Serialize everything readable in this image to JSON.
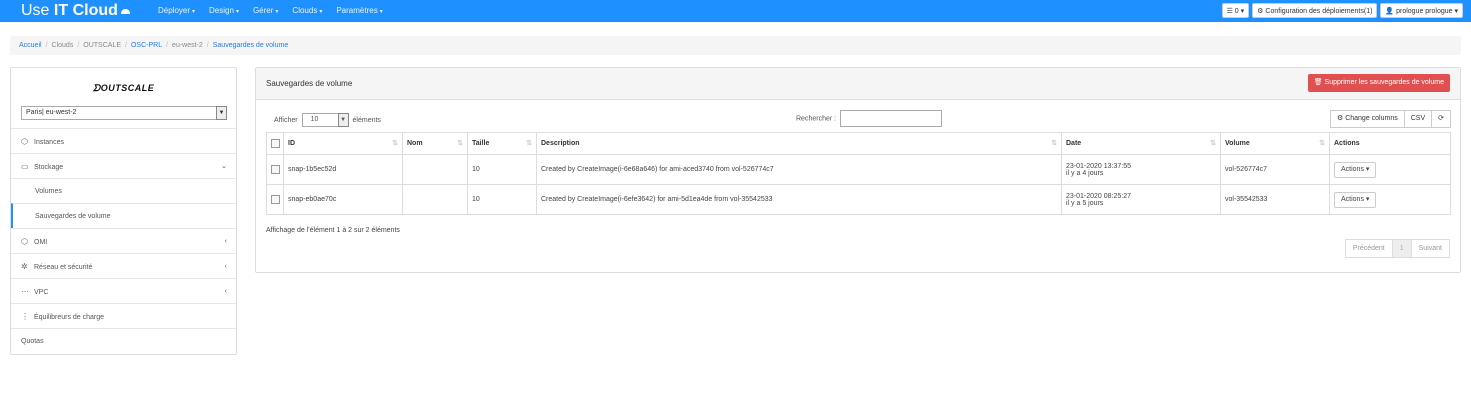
{
  "brand": {
    "light": "Use ",
    "bold": "IT Cloud"
  },
  "nav": [
    {
      "label": "Déployer"
    },
    {
      "label": "Design"
    },
    {
      "label": "Gérer"
    },
    {
      "label": "Clouds"
    },
    {
      "label": "Paramètres"
    }
  ],
  "navright": {
    "tasks": "0",
    "config": "Configuration des déploiements(1)",
    "user": "prologue prologue"
  },
  "breadcrumb": {
    "accueil": "Accueil",
    "clouds": "Clouds",
    "outscale": "OUTSCALE",
    "osc": "OSC-PRL",
    "region": "eu-west-2",
    "current": "Sauvegardes de volume"
  },
  "sidebar": {
    "logo": "OUTSCALE",
    "region": "Paris| eu-west-2",
    "items": [
      {
        "label": "Instances",
        "icon": "cube-icon"
      },
      {
        "label": "Stockage",
        "icon": "hdd-icon"
      },
      {
        "label": "Volumes"
      },
      {
        "label": "Sauvegardes de volume"
      },
      {
        "label": "OMI",
        "icon": "cube-icon"
      },
      {
        "label": "Réseau et sécurité",
        "icon": "network-icon"
      },
      {
        "label": "VPC",
        "icon": "vpc-icon"
      },
      {
        "label": "Équilibreurs de charge",
        "icon": "balancer-icon"
      },
      {
        "label": "Quotas"
      }
    ]
  },
  "panel": {
    "title": "Sauvegardes de volume",
    "delete_btn": "Supprimer les sauvegardes de volume",
    "show_prefix": "Afficher",
    "show_value": "10",
    "show_suffix": "éléments",
    "search_label": "Rechercher :",
    "change_columns": "Change columns",
    "csv": "CSV",
    "columns": [
      "ID",
      "Nom",
      "Taille",
      "Description",
      "Date",
      "Volume",
      "Actions"
    ],
    "rows": [
      {
        "id": "snap-1b5ec52d",
        "nom": "",
        "taille": "10",
        "description": "Created by CreateImage(i-6e68a646) for ami-aced3740 from vol-526774c7",
        "date": "23-01-2020 13:37:55",
        "ago": "il y a 4 jours",
        "volume": "vol-526774c7",
        "actions": "Actions"
      },
      {
        "id": "snap-eb0ae70c",
        "nom": "",
        "taille": "10",
        "description": "Created by CreateImage(i-6efe3642) for ami-5d1ea4de from vol-35542533",
        "date": "23-01-2020 08:25:27",
        "ago": "il y a 5 jours",
        "volume": "vol-35542533",
        "actions": "Actions"
      }
    ],
    "info": "Affichage de l'élément 1 à 2 sur 2 éléments",
    "prev": "Précédent",
    "page": "1",
    "next": "Suivant"
  }
}
